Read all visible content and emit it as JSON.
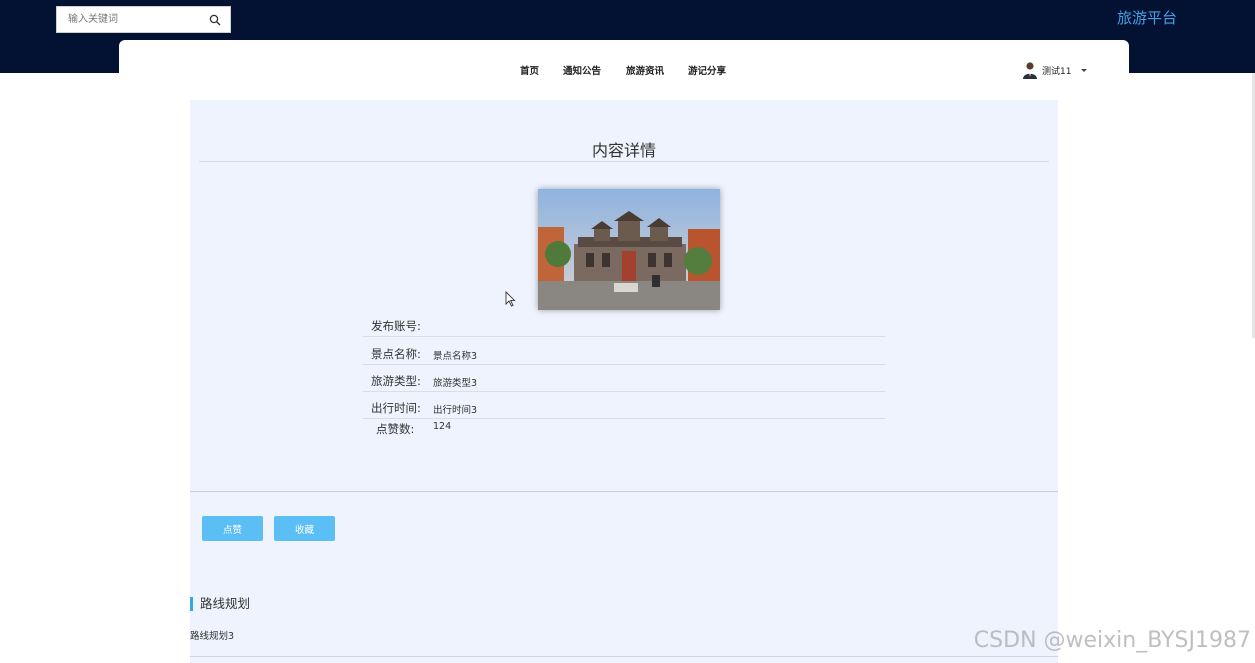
{
  "header": {
    "search_placeholder": "输入关键词",
    "search_icon": "search-icon",
    "brand": "旅游平台"
  },
  "nav": {
    "items": [
      "首页",
      "通知公告",
      "旅游资讯",
      "游记分享"
    ],
    "user_name": "测试11"
  },
  "detail": {
    "title": "内容详情",
    "fields": [
      {
        "label": "发布账号:",
        "value": ""
      },
      {
        "label": "景点名称:",
        "value": "景点名称3"
      },
      {
        "label": "旅游类型:",
        "value": "旅游类型3"
      },
      {
        "label": "出行时间:",
        "value": "出行时间3"
      },
      {
        "label": "点赞数:",
        "value": "124"
      }
    ]
  },
  "actions": {
    "like_label": "点赞",
    "favorite_label": "收藏"
  },
  "route": {
    "title": "路线规划",
    "text": "路线规划3"
  },
  "watermark": "CSDN @weixin_BYSJ1987",
  "colors": {
    "header_bg": "#031233",
    "brand": "#45a0e8",
    "content_bg": "#eef3fd",
    "button": "#5bbef5",
    "accent_bar": "#37a6e6"
  }
}
